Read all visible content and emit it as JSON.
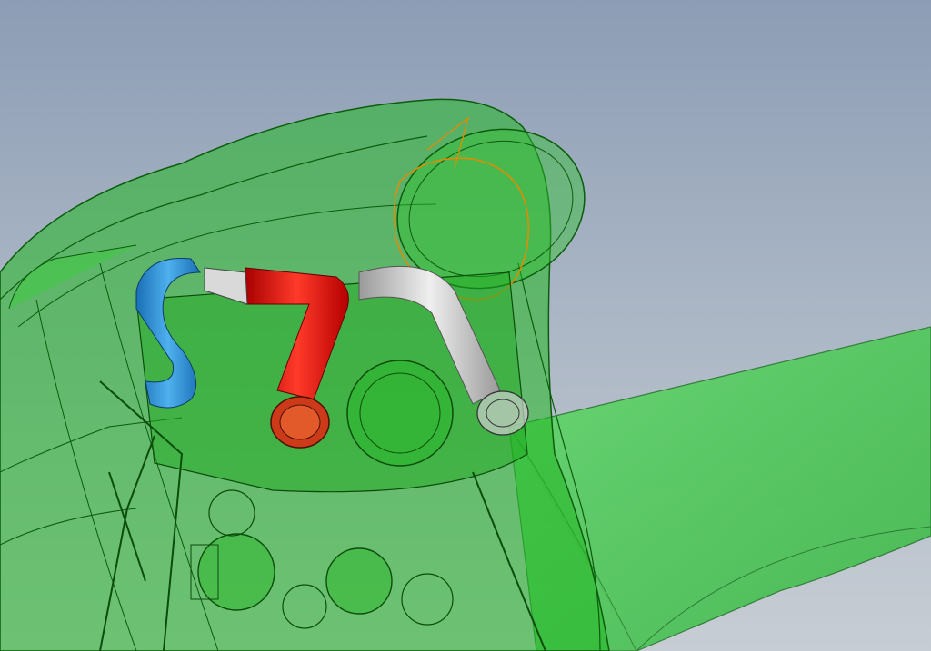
{
  "scene": {
    "kind": "cad-assembly-view",
    "render_style": "transparent-shaded",
    "colors": {
      "background_top": "#8c9db5",
      "background_bottom": "#c7cdd4",
      "housing_green": "#1fb81f",
      "housing_edge": "#0b5c0b",
      "blade_green": "#5fd06a",
      "pipe_blue": "#2e8fd6",
      "pipe_red": "#e01010",
      "pipe_gray": "#c9c9c9",
      "sketch_orange": "#e68a00"
    }
  }
}
